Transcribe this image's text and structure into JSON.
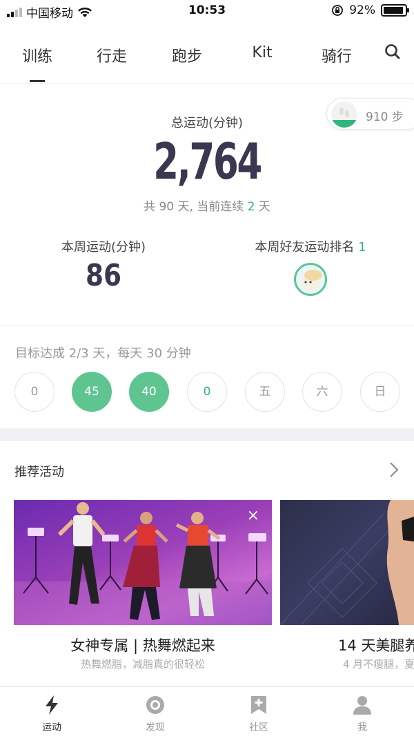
{
  "status_bar": {
    "carrier": "中国移动",
    "time": "10:53",
    "battery": "92%",
    "battery_level": 0.92
  },
  "tabs": [
    {
      "label": "训练",
      "active": true
    },
    {
      "label": "行走",
      "active": false
    },
    {
      "label": "跑步",
      "active": false
    },
    {
      "label": "Kit",
      "active": false
    },
    {
      "label": "骑行",
      "active": false
    }
  ],
  "steps": {
    "text": "910 步"
  },
  "total": {
    "label": "总运动(分钟)",
    "value": "2,764",
    "days_prefix": "共 90 天, 当前连续 ",
    "streak": "2",
    "days_suffix": " 天"
  },
  "week": {
    "label": "本周运动(分钟)",
    "value": "86"
  },
  "ranking": {
    "label": "本周好友运动排名 ",
    "rank": "1"
  },
  "goal": {
    "text": "目标达成 2/3 天，每天 30 分钟",
    "days": [
      {
        "label": "0",
        "state": "empty"
      },
      {
        "label": "45",
        "state": "done"
      },
      {
        "label": "40",
        "state": "done"
      },
      {
        "label": "0",
        "state": "today"
      },
      {
        "label": "五",
        "state": "future"
      },
      {
        "label": "六",
        "state": "future"
      },
      {
        "label": "日",
        "state": "future"
      }
    ]
  },
  "recommend": {
    "title": "推荐活动",
    "cards": [
      {
        "title": "女神专属 | 热舞燃起来",
        "subtitle": "热舞燃脂，减脂真的很轻松",
        "close": "×"
      },
      {
        "title": "14 天美腿养",
        "subtitle": "4 月不瘦腿，夏"
      }
    ]
  },
  "bottom_nav": [
    {
      "label": "运动",
      "icon": "lightning-icon",
      "active": true
    },
    {
      "label": "发现",
      "icon": "discover-icon",
      "active": false
    },
    {
      "label": "社区",
      "icon": "community-icon",
      "active": false
    },
    {
      "label": "我",
      "icon": "profile-icon",
      "active": false
    }
  ],
  "colors": {
    "accent": "#2fb67c",
    "day_done": "#5ec591",
    "number": "#3b3750"
  }
}
